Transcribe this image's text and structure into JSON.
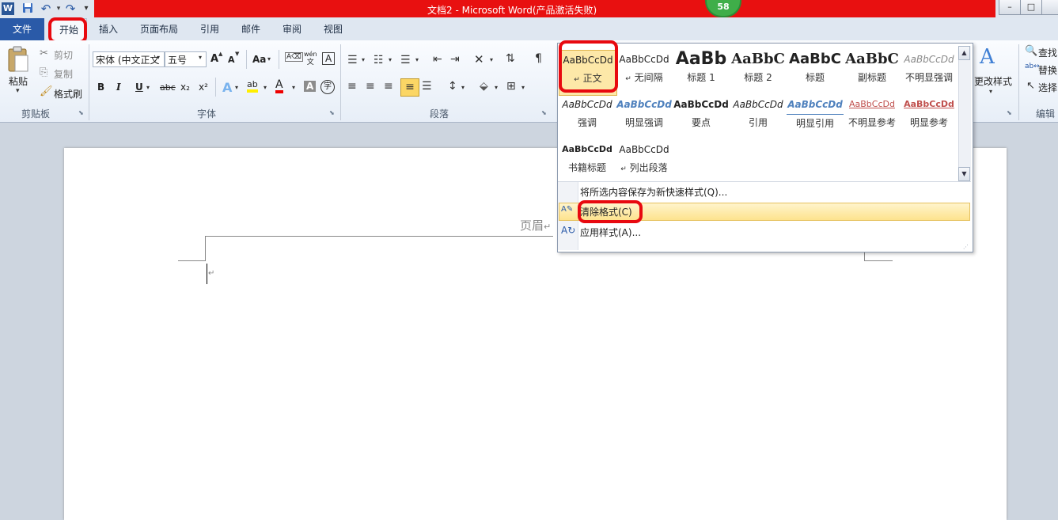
{
  "window": {
    "title": "文档2 - Microsoft Word(产品激活失败)",
    "badge": "58",
    "controls": [
      "–",
      "□"
    ]
  },
  "quick_access": {
    "word_icon": "W",
    "save_icon": "💾",
    "undo_icon": "↶",
    "redo_icon": "↷",
    "customize_icon": "▾"
  },
  "tabs": {
    "file": "文件",
    "items": [
      "开始",
      "插入",
      "页面布局",
      "引用",
      "邮件",
      "审阅",
      "视图"
    ]
  },
  "clipboard": {
    "paste": "粘贴",
    "cut": "剪切",
    "copy": "复制",
    "format_painter": "格式刷",
    "group_label": "剪贴板"
  },
  "font": {
    "font_name": "宋体 (中文正文",
    "font_size": "五号",
    "grow": "A",
    "shrink": "A",
    "change_case": "Aa",
    "bold": "B",
    "italic": "I",
    "underline": "U",
    "strike": "abc",
    "subscript": "x₂",
    "superscript": "x²",
    "effects": "A",
    "highlight": "ab",
    "font_color": "A",
    "char_shading": "A",
    "enclose": "字",
    "phonetic": "wén",
    "group_label": "字体"
  },
  "paragraph": {
    "group_label": "段落"
  },
  "styles_gallery": {
    "rows": [
      [
        {
          "sample": "AaBbCcDd",
          "name": "正文",
          "prefix": "↵"
        },
        {
          "sample": "AaBbCcDd",
          "name": "无间隔",
          "prefix": "↵"
        },
        {
          "sample": "AaBb",
          "name": "标题 1",
          "prefix": ""
        },
        {
          "sample": "AaBbC",
          "name": "标题 2",
          "prefix": ""
        },
        {
          "sample": "AaBbC",
          "name": "标题",
          "prefix": ""
        },
        {
          "sample": "AaBbC",
          "name": "副标题",
          "prefix": ""
        },
        {
          "sample": "AaBbCcDd",
          "name": "不明显强调",
          "prefix": ""
        }
      ],
      [
        {
          "sample": "AaBbCcDd",
          "name": "强调",
          "prefix": ""
        },
        {
          "sample": "AaBbCcDd",
          "name": "明显强调",
          "prefix": ""
        },
        {
          "sample": "AaBbCcDd",
          "name": "要点",
          "prefix": ""
        },
        {
          "sample": "AaBbCcDd",
          "name": "引用",
          "prefix": ""
        },
        {
          "sample": "AaBbCcDd",
          "name": "明显引用",
          "prefix": ""
        },
        {
          "sample": "AaBbCcDd",
          "name": "不明显参考",
          "prefix": ""
        },
        {
          "sample": "AaBbCcDd",
          "name": "明显参考",
          "prefix": ""
        }
      ],
      [
        {
          "sample": "AaBbCcDd",
          "name": "书籍标题",
          "prefix": ""
        },
        {
          "sample": "AaBbCcDd",
          "name": "列出段落",
          "prefix": "↵"
        }
      ]
    ],
    "menu": {
      "save_new": "将所选内容保存为新快速样式(Q)...",
      "clear_format": "清除格式(C)",
      "apply_styles": "应用样式(A)..."
    }
  },
  "change_styles": {
    "label": "更改样式"
  },
  "editing": {
    "find": "查找",
    "replace": "替换",
    "select": "选择",
    "group_label": "编辑"
  },
  "document": {
    "header_label": "页眉",
    "return_mark": "↵"
  },
  "colors": {
    "accent": "#2a5aa8",
    "title_red": "#e81010",
    "annotation_red": "#e8090f",
    "hover_yellow": "#fde38d"
  }
}
